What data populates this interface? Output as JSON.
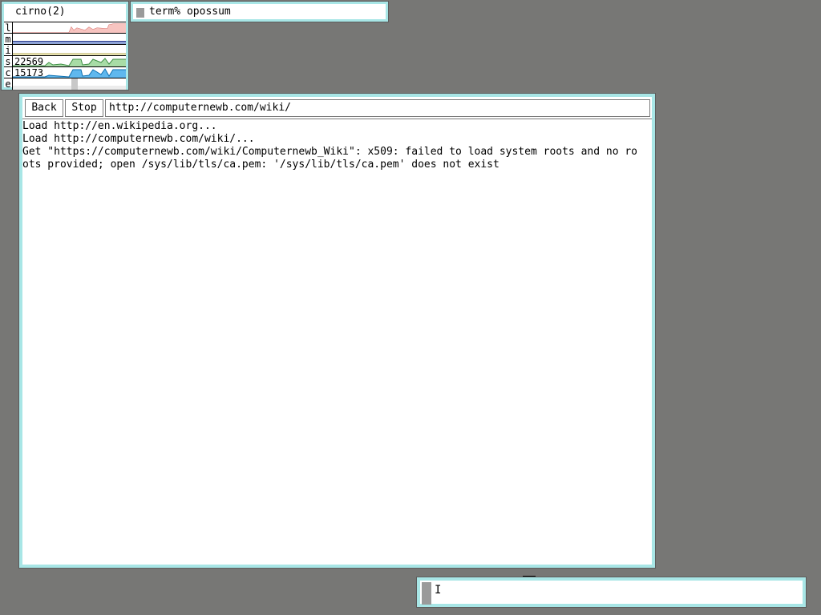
{
  "stats": {
    "host": "cirno(2)",
    "rows": [
      {
        "key": "l",
        "value": "",
        "color": "#f29b96"
      },
      {
        "key": "m",
        "value": "",
        "color": "#2b3a8c"
      },
      {
        "key": "i",
        "value": "",
        "color": "#e8e2a0"
      },
      {
        "key": "s",
        "value": "22569",
        "color": "#6fba72"
      },
      {
        "key": "c",
        "value": "15173",
        "color": "#1f8fd6"
      },
      {
        "key": "e",
        "value": "",
        "color": "#d0d0d0"
      }
    ]
  },
  "term": {
    "label": "term% opossum"
  },
  "browser": {
    "back_label": "Back",
    "stop_label": "Stop",
    "url": "http://computernewb.com/wiki/",
    "log": [
      "Load http://en.wikipedia.org...",
      "Load http://computernewb.com/wiki/...",
      "Get \"https://computernewb.com/wiki/Computernewb_Wiki\": x509: failed to load system roots and no ro",
      "ots provided; open /sys/lib/tls/ca.pem: '/sys/lib/tls/ca.pem' does not exist"
    ]
  },
  "cmd": {
    "cursor_glyph": "I"
  },
  "colors": {
    "desktop": "#777775",
    "window_border": "#a8e6e6"
  }
}
